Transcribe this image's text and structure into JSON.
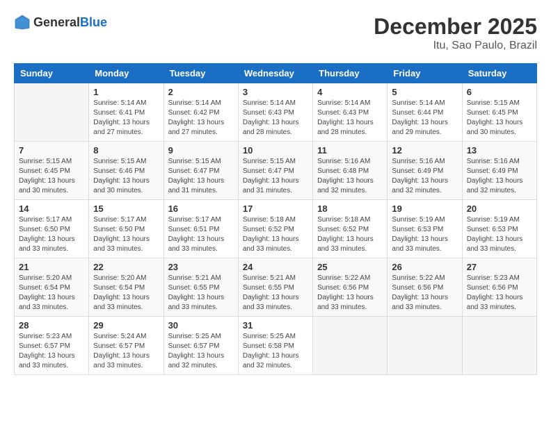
{
  "header": {
    "logo_general": "General",
    "logo_blue": "Blue",
    "month": "December 2025",
    "location": "Itu, Sao Paulo, Brazil"
  },
  "columns": [
    "Sunday",
    "Monday",
    "Tuesday",
    "Wednesday",
    "Thursday",
    "Friday",
    "Saturday"
  ],
  "weeks": [
    [
      {
        "day": "",
        "sunrise": "",
        "sunset": "",
        "daylight": ""
      },
      {
        "day": "1",
        "sunrise": "Sunrise: 5:14 AM",
        "sunset": "Sunset: 6:41 PM",
        "daylight": "Daylight: 13 hours and 27 minutes."
      },
      {
        "day": "2",
        "sunrise": "Sunrise: 5:14 AM",
        "sunset": "Sunset: 6:42 PM",
        "daylight": "Daylight: 13 hours and 27 minutes."
      },
      {
        "day": "3",
        "sunrise": "Sunrise: 5:14 AM",
        "sunset": "Sunset: 6:43 PM",
        "daylight": "Daylight: 13 hours and 28 minutes."
      },
      {
        "day": "4",
        "sunrise": "Sunrise: 5:14 AM",
        "sunset": "Sunset: 6:43 PM",
        "daylight": "Daylight: 13 hours and 28 minutes."
      },
      {
        "day": "5",
        "sunrise": "Sunrise: 5:14 AM",
        "sunset": "Sunset: 6:44 PM",
        "daylight": "Daylight: 13 hours and 29 minutes."
      },
      {
        "day": "6",
        "sunrise": "Sunrise: 5:15 AM",
        "sunset": "Sunset: 6:45 PM",
        "daylight": "Daylight: 13 hours and 30 minutes."
      }
    ],
    [
      {
        "day": "7",
        "sunrise": "Sunrise: 5:15 AM",
        "sunset": "Sunset: 6:45 PM",
        "daylight": "Daylight: 13 hours and 30 minutes."
      },
      {
        "day": "8",
        "sunrise": "Sunrise: 5:15 AM",
        "sunset": "Sunset: 6:46 PM",
        "daylight": "Daylight: 13 hours and 30 minutes."
      },
      {
        "day": "9",
        "sunrise": "Sunrise: 5:15 AM",
        "sunset": "Sunset: 6:47 PM",
        "daylight": "Daylight: 13 hours and 31 minutes."
      },
      {
        "day": "10",
        "sunrise": "Sunrise: 5:15 AM",
        "sunset": "Sunset: 6:47 PM",
        "daylight": "Daylight: 13 hours and 31 minutes."
      },
      {
        "day": "11",
        "sunrise": "Sunrise: 5:16 AM",
        "sunset": "Sunset: 6:48 PM",
        "daylight": "Daylight: 13 hours and 32 minutes."
      },
      {
        "day": "12",
        "sunrise": "Sunrise: 5:16 AM",
        "sunset": "Sunset: 6:49 PM",
        "daylight": "Daylight: 13 hours and 32 minutes."
      },
      {
        "day": "13",
        "sunrise": "Sunrise: 5:16 AM",
        "sunset": "Sunset: 6:49 PM",
        "daylight": "Daylight: 13 hours and 32 minutes."
      }
    ],
    [
      {
        "day": "14",
        "sunrise": "Sunrise: 5:17 AM",
        "sunset": "Sunset: 6:50 PM",
        "daylight": "Daylight: 13 hours and 33 minutes."
      },
      {
        "day": "15",
        "sunrise": "Sunrise: 5:17 AM",
        "sunset": "Sunset: 6:50 PM",
        "daylight": "Daylight: 13 hours and 33 minutes."
      },
      {
        "day": "16",
        "sunrise": "Sunrise: 5:17 AM",
        "sunset": "Sunset: 6:51 PM",
        "daylight": "Daylight: 13 hours and 33 minutes."
      },
      {
        "day": "17",
        "sunrise": "Sunrise: 5:18 AM",
        "sunset": "Sunset: 6:52 PM",
        "daylight": "Daylight: 13 hours and 33 minutes."
      },
      {
        "day": "18",
        "sunrise": "Sunrise: 5:18 AM",
        "sunset": "Sunset: 6:52 PM",
        "daylight": "Daylight: 13 hours and 33 minutes."
      },
      {
        "day": "19",
        "sunrise": "Sunrise: 5:19 AM",
        "sunset": "Sunset: 6:53 PM",
        "daylight": "Daylight: 13 hours and 33 minutes."
      },
      {
        "day": "20",
        "sunrise": "Sunrise: 5:19 AM",
        "sunset": "Sunset: 6:53 PM",
        "daylight": "Daylight: 13 hours and 33 minutes."
      }
    ],
    [
      {
        "day": "21",
        "sunrise": "Sunrise: 5:20 AM",
        "sunset": "Sunset: 6:54 PM",
        "daylight": "Daylight: 13 hours and 33 minutes."
      },
      {
        "day": "22",
        "sunrise": "Sunrise: 5:20 AM",
        "sunset": "Sunset: 6:54 PM",
        "daylight": "Daylight: 13 hours and 33 minutes."
      },
      {
        "day": "23",
        "sunrise": "Sunrise: 5:21 AM",
        "sunset": "Sunset: 6:55 PM",
        "daylight": "Daylight: 13 hours and 33 minutes."
      },
      {
        "day": "24",
        "sunrise": "Sunrise: 5:21 AM",
        "sunset": "Sunset: 6:55 PM",
        "daylight": "Daylight: 13 hours and 33 minutes."
      },
      {
        "day": "25",
        "sunrise": "Sunrise: 5:22 AM",
        "sunset": "Sunset: 6:56 PM",
        "daylight": "Daylight: 13 hours and 33 minutes."
      },
      {
        "day": "26",
        "sunrise": "Sunrise: 5:22 AM",
        "sunset": "Sunset: 6:56 PM",
        "daylight": "Daylight: 13 hours and 33 minutes."
      },
      {
        "day": "27",
        "sunrise": "Sunrise: 5:23 AM",
        "sunset": "Sunset: 6:56 PM",
        "daylight": "Daylight: 13 hours and 33 minutes."
      }
    ],
    [
      {
        "day": "28",
        "sunrise": "Sunrise: 5:23 AM",
        "sunset": "Sunset: 6:57 PM",
        "daylight": "Daylight: 13 hours and 33 minutes."
      },
      {
        "day": "29",
        "sunrise": "Sunrise: 5:24 AM",
        "sunset": "Sunset: 6:57 PM",
        "daylight": "Daylight: 13 hours and 33 minutes."
      },
      {
        "day": "30",
        "sunrise": "Sunrise: 5:25 AM",
        "sunset": "Sunset: 6:57 PM",
        "daylight": "Daylight: 13 hours and 32 minutes."
      },
      {
        "day": "31",
        "sunrise": "Sunrise: 5:25 AM",
        "sunset": "Sunset: 6:58 PM",
        "daylight": "Daylight: 13 hours and 32 minutes."
      },
      {
        "day": "",
        "sunrise": "",
        "sunset": "",
        "daylight": ""
      },
      {
        "day": "",
        "sunrise": "",
        "sunset": "",
        "daylight": ""
      },
      {
        "day": "",
        "sunrise": "",
        "sunset": "",
        "daylight": ""
      }
    ]
  ]
}
